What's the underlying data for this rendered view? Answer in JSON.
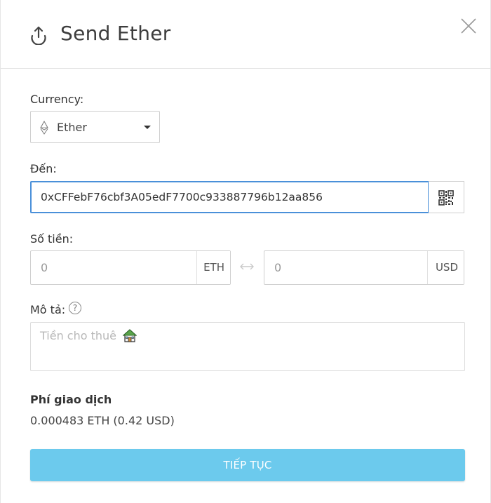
{
  "header": {
    "title": "Send Ether",
    "icon": "upload-icon",
    "close_icon": "close-icon"
  },
  "currency": {
    "label": "Currency:",
    "selected": "Ether",
    "icon": "ethereum-icon"
  },
  "to": {
    "label": "Đến:",
    "value": "0xCFFebF76cbf3A05edF7700c933887796b12aa856",
    "qr_icon": "qr-code-icon"
  },
  "amount": {
    "label": "Số tiền:",
    "eth_placeholder": "0",
    "eth_unit": "ETH",
    "usd_placeholder": "0",
    "usd_unit": "USD",
    "swap_icon": "swap-arrows-icon"
  },
  "description": {
    "label": "Mô tả:",
    "help_icon": "?",
    "placeholder": "Tiền cho thuê"
  },
  "fee": {
    "label": "Phí giao dịch",
    "value": "0.000483 ETH (0.42 USD)"
  },
  "actions": {
    "continue_label": "TIẾP TỤC"
  },
  "colors": {
    "accent": "#4a90d9",
    "button": "#6ccaed"
  }
}
